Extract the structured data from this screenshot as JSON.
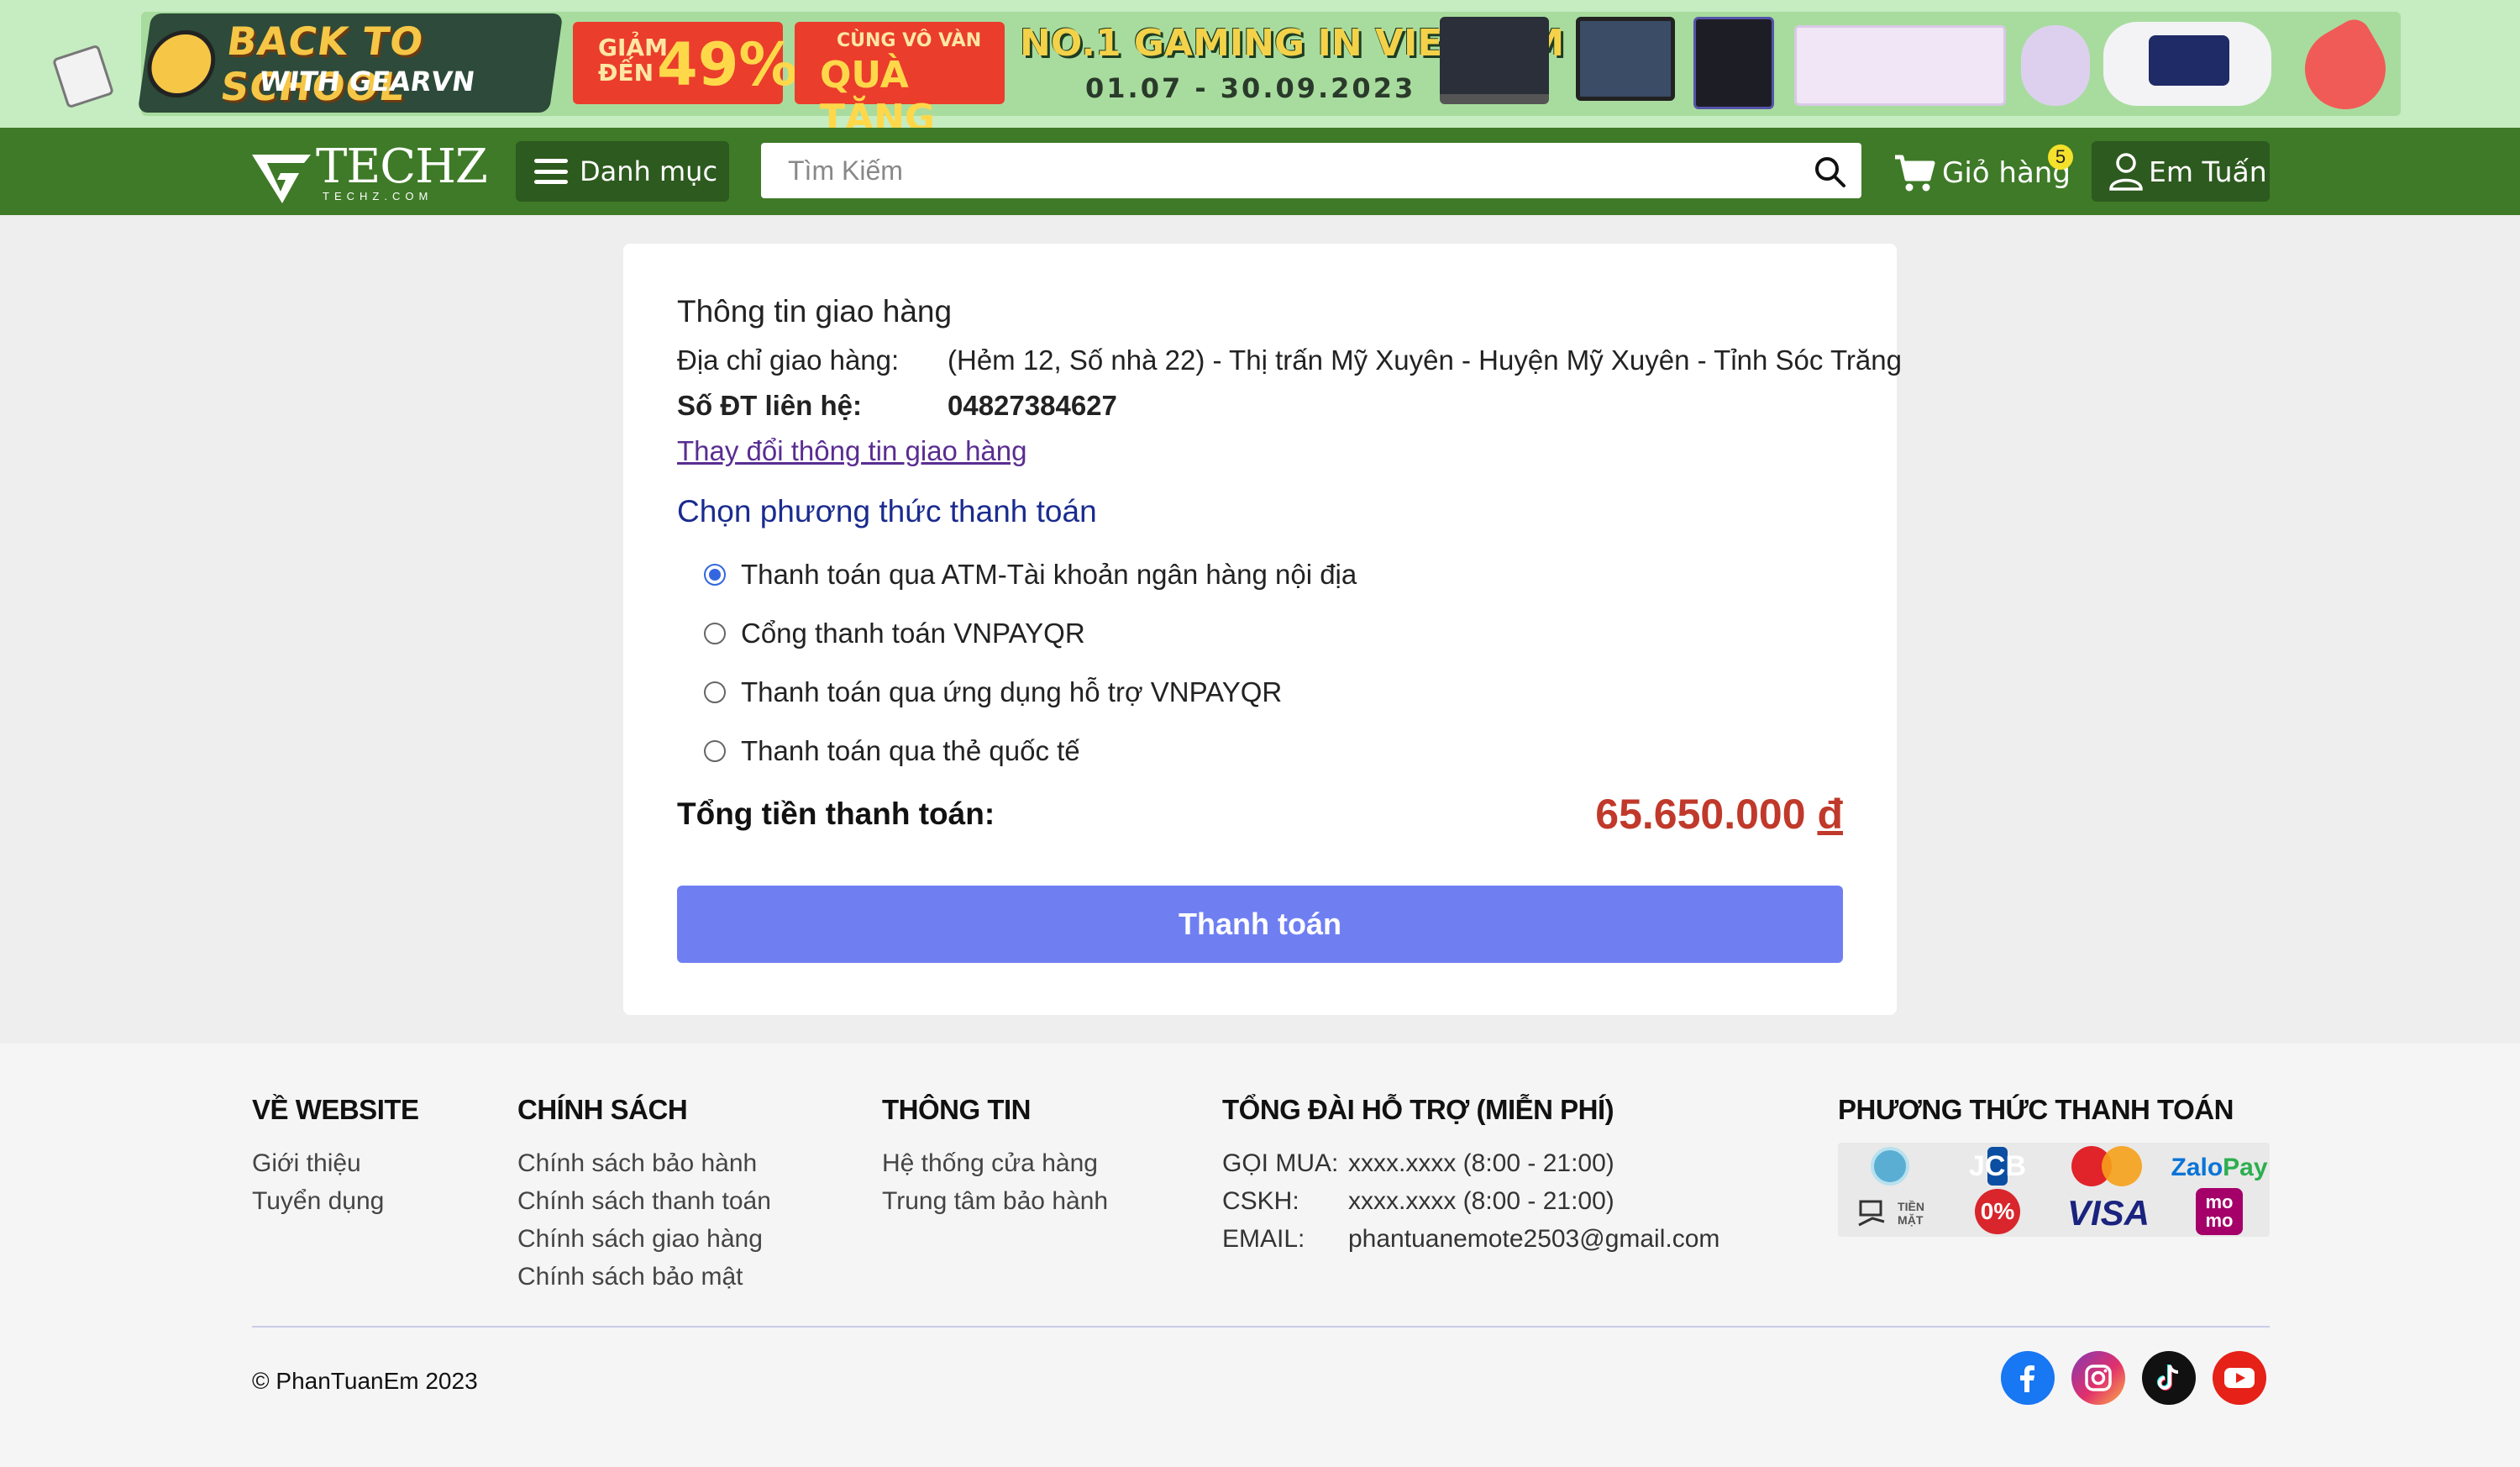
{
  "banner": {
    "headline_1": "BACK TO SCHOOL",
    "headline_2": "WITH GEARVN",
    "sale_small": "GIẢM\nĐẾN",
    "sale_big": "49%",
    "gift_small": "CÙNG VÔ VÀN",
    "gift_big": "QUÀ TẶNG",
    "gaming_title": "NO.1 GAMING IN VIETNAM",
    "gaming_dates": "01.07 - 30.09.2023"
  },
  "header": {
    "logo_text": "TECHZ",
    "logo_subtext": "TECHZ.COM",
    "menu_label": "Danh mục",
    "search_placeholder": "Tìm Kiếm",
    "cart_label": "Giỏ hàng",
    "cart_count": "5",
    "user_name": "Em Tuấn"
  },
  "shipping": {
    "title": "Thông tin giao hàng",
    "address_label": "Địa chỉ giao hàng:",
    "address_value": "(Hẻm 12, Số nhà 22) - Thị trấn Mỹ Xuyên - Huyện Mỹ Xuyên - Tỉnh Sóc Trăng",
    "phone_label": "Số ĐT liên hệ:",
    "phone_value": "04827384627",
    "change_link": "Thay đổi thông tin giao hàng"
  },
  "payment": {
    "title": "Chọn phương thức thanh toán",
    "options": [
      {
        "label": "Thanh toán qua ATM-Tài khoản ngân hàng nội địa",
        "selected": true
      },
      {
        "label": "Cổng thanh toán VNPAYQR",
        "selected": false
      },
      {
        "label": "Thanh toán qua ứng dụng hỗ trợ VNPAYQR",
        "selected": false
      },
      {
        "label": "Thanh toán qua thẻ quốc tế",
        "selected": false
      }
    ],
    "total_label": "Tổng tiền thanh toán:",
    "total_amount": "65.650.000",
    "currency": "đ",
    "submit_label": "Thanh toán",
    "accent_color": "#6f7ff2",
    "total_color": "#c0392b"
  },
  "footer": {
    "about": {
      "title": "VỀ WEBSITE",
      "links": [
        "Giới thiệu",
        "Tuyển dụng"
      ]
    },
    "policy": {
      "title": "CHÍNH SÁCH",
      "links": [
        "Chính sách bảo hành",
        "Chính sách thanh toán",
        "Chính sách giao hàng",
        "Chính sách bảo mật"
      ]
    },
    "info": {
      "title": "THÔNG TIN",
      "links": [
        "Hệ thống cửa hàng",
        "Trung tâm bảo hành"
      ]
    },
    "hotline": {
      "title": "TỔNG ĐÀI HỖ TRỢ (MIỄN PHÍ)",
      "rows": [
        {
          "key": "GỌI MUA:",
          "value": "xxxx.xxxx (8:00 - 21:00)"
        },
        {
          "key": "CSKH:",
          "value": "xxxx.xxxx (8:00 - 21:00)"
        },
        {
          "key": "EMAIL:",
          "value": "phantuanemote2503@gmail.com"
        }
      ]
    },
    "payment_methods": {
      "title": "PHƯƠNG THỨC THANH TOÁN",
      "icons": [
        "internet-banking-icon",
        "jcb-icon",
        "mastercard-icon",
        "zalopay-icon",
        "cash-icon",
        "installment-0-icon",
        "visa-icon",
        "momo-icon"
      ],
      "labels": {
        "jcb": "JCB",
        "mastercard": "MasterCard",
        "zalo": "Zalo",
        "zalo_pay": "Pay",
        "cash": "TIỀN\nMẶT",
        "zero": "0%",
        "visa": "VISA",
        "momo": "mo\nmo"
      }
    },
    "copyright": "© PhanTuanEm 2023",
    "socials": [
      "facebook-icon",
      "instagram-icon",
      "tiktok-icon",
      "youtube-icon"
    ]
  }
}
